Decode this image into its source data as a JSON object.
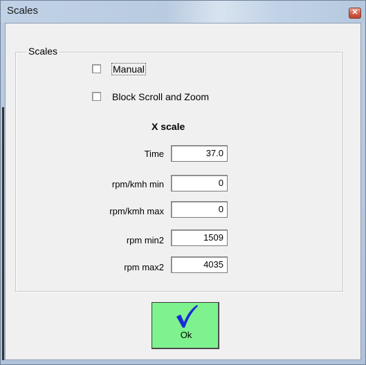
{
  "window": {
    "title": "Scales"
  },
  "group": {
    "label": "Scales"
  },
  "checkboxes": {
    "manual": {
      "label": "Manual",
      "checked": false
    },
    "block": {
      "label": "Block Scroll and Zoom",
      "checked": false
    }
  },
  "section": {
    "title": "X scale"
  },
  "fields": [
    {
      "label": "Time",
      "value": "37.0"
    },
    {
      "label": "rpm/kmh min",
      "value": "0"
    },
    {
      "label": "rpm/kmh max",
      "value": "0"
    },
    {
      "label": "rpm min2",
      "value": "1509"
    },
    {
      "label": "rpm max2",
      "value": "4035"
    }
  ],
  "ok_button": {
    "label": "Ok",
    "icon": "checkmark-icon",
    "color": "#7ef28e"
  },
  "colors": {
    "checkmark": "#1a2bd6",
    "close": "#c0442d"
  }
}
